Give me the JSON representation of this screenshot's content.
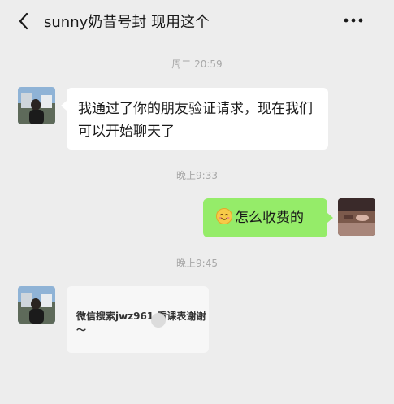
{
  "header": {
    "title": "sunny奶昔号封 现用这个",
    "back_icon": "chevron-left-icon",
    "more_icon": "more-dots-icon"
  },
  "messages": [
    {
      "type": "timestamp",
      "text": "周二 20:59"
    },
    {
      "type": "incoming",
      "text": "我通过了你的朋友验证请求，现在我们可以开始聊天了",
      "avatar": "contact-avatar"
    },
    {
      "type": "timestamp",
      "text": "晚上9:33"
    },
    {
      "type": "outgoing",
      "text": "怎么收费的",
      "emoji": "smiling-face-icon",
      "avatar": "my-avatar"
    },
    {
      "type": "timestamp",
      "text": "晚上9:45"
    },
    {
      "type": "incoming",
      "text": "微信搜索jwz961 看课表谢谢～",
      "avatar": "contact-avatar"
    }
  ],
  "colors": {
    "background": "#ededed",
    "incoming_bubble": "#ffffff",
    "outgoing_bubble": "#95ec69",
    "timestamp": "#a8a8a8"
  }
}
